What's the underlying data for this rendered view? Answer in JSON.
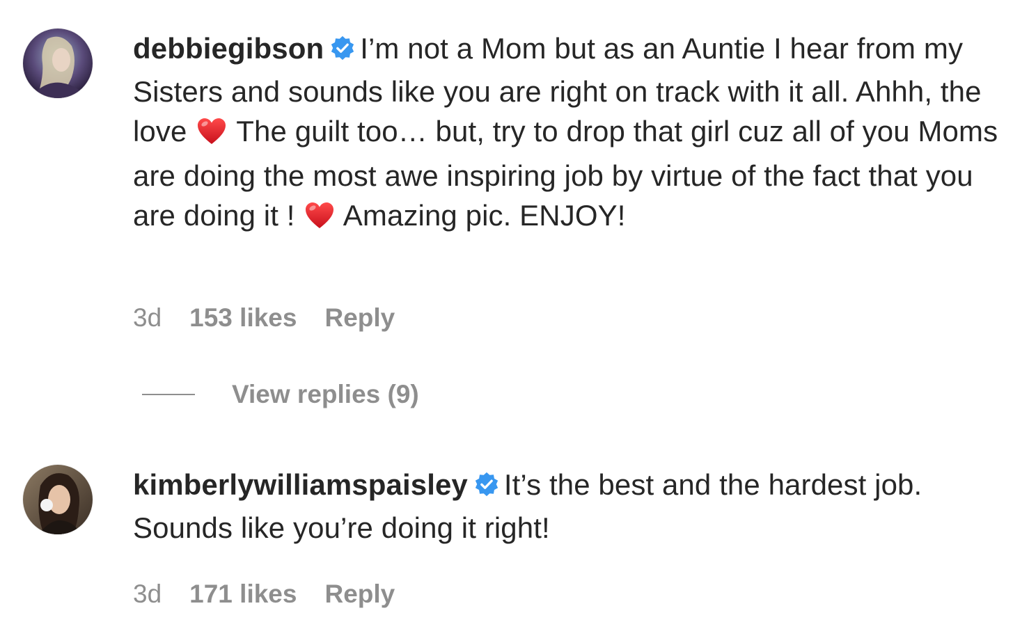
{
  "colors": {
    "text": "#262626",
    "muted": "#8e8e8e",
    "verified_blue": "#3897f0",
    "heart_red": "#e0252f"
  },
  "comments": [
    {
      "username": "debbiegibson",
      "verified": true,
      "text_parts": [
        "I’m not a Mom but as an Auntie I hear from my Sisters and sounds like you are right on track with it all. Ahhh, the love",
        "The guilt too… but, try to drop that girl cuz all of you Moms are doing the most awe inspiring job by virtue of the fact that you are doing it !",
        "Amazing pic. ENJOY!"
      ],
      "emoji": "heart",
      "time": "3d",
      "likes": "153 likes",
      "reply_label": "Reply",
      "view_replies": "View replies (9)"
    },
    {
      "username": "kimberlywilliamspaisley",
      "verified": true,
      "text": "It’s the best and the hardest job. Sounds like you’re doing it right!",
      "time": "3d",
      "likes": "171 likes",
      "reply_label": "Reply"
    }
  ]
}
